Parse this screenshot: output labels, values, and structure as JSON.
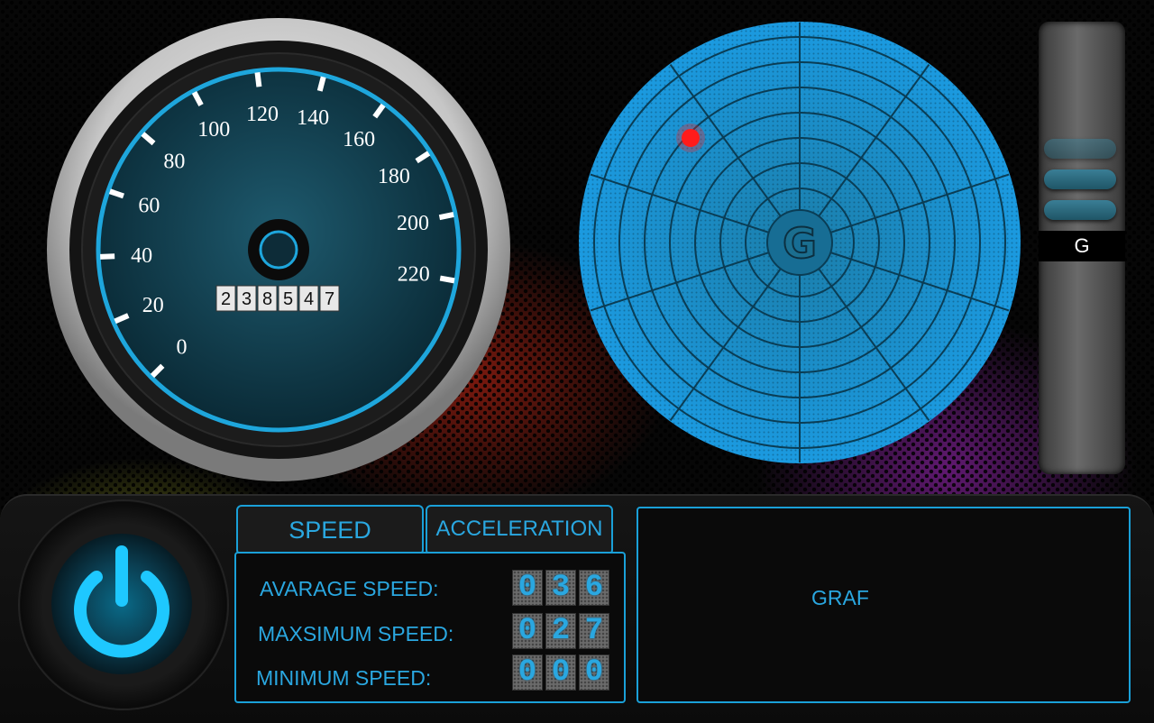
{
  "speedometer": {
    "ticks": [
      "0",
      "20",
      "40",
      "60",
      "80",
      "100",
      "120",
      "140",
      "160",
      "180",
      "200",
      "220"
    ],
    "odometer": [
      "2",
      "3",
      "8",
      "5",
      "4",
      "7"
    ]
  },
  "radar": {
    "center_label": "G",
    "marker_color": "#ff1a1a"
  },
  "slider": {
    "label": "G"
  },
  "tabs": {
    "speed": "SPEED",
    "acceleration": "ACCELERATION"
  },
  "stats": {
    "average": {
      "label": "AVARAGE SPEED:",
      "digits": [
        "0",
        "3",
        "6"
      ]
    },
    "maximum": {
      "label": "MAXSIMUM SPEED:",
      "digits": [
        "0",
        "2",
        "7"
      ]
    },
    "minimum": {
      "label": "MINIMUM SPEED:",
      "digits": [
        "0",
        "0",
        "0"
      ]
    }
  },
  "graph": {
    "label": "GRAF"
  },
  "colors": {
    "accent": "#2aa7e0",
    "dial_face": "#0f3a48"
  }
}
